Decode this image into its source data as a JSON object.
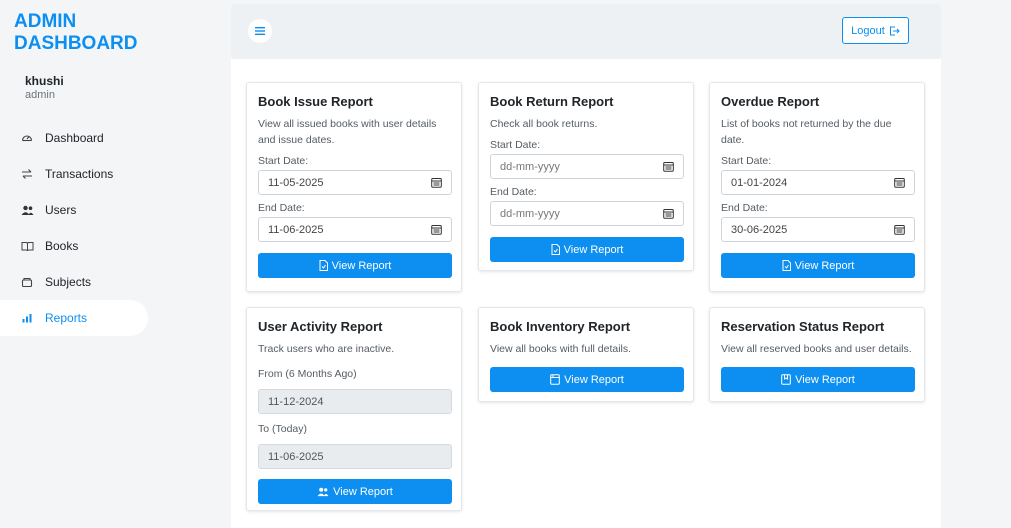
{
  "sidebar": {
    "brand": "ADMIN DASHBOARD",
    "user": {
      "name": "khushi",
      "role": "admin"
    },
    "items": [
      {
        "label": "Dashboard",
        "icon": "dashboard-icon"
      },
      {
        "label": "Transactions",
        "icon": "transactions-icon"
      },
      {
        "label": "Users",
        "icon": "users-icon"
      },
      {
        "label": "Books",
        "icon": "book-icon"
      },
      {
        "label": "Subjects",
        "icon": "subjects-icon"
      },
      {
        "label": "Reports",
        "icon": "reports-icon",
        "active": true
      }
    ]
  },
  "header": {
    "logout_label": "Logout"
  },
  "colors": {
    "accent": "#0d8ff2",
    "sidebar_bg": "#f3f5f7",
    "readonly_bg": "#e9ecef"
  },
  "cards": {
    "issue": {
      "title": "Book Issue Report",
      "desc": "View all issued books with user details and issue dates.",
      "start_label": "Start Date:",
      "start_value": "11-05-2025",
      "end_label": "End Date:",
      "end_value": "11-06-2025",
      "button": "View Report"
    },
    "return": {
      "title": "Book Return Report",
      "desc": "Check all book returns.",
      "start_label": "Start Date:",
      "start_value": "dd-mm-yyyy",
      "end_label": "End Date:",
      "end_value": "dd-mm-yyyy",
      "button": "View Report"
    },
    "overdue": {
      "title": "Overdue Report",
      "desc": "List of books not returned by the due date.",
      "start_label": "Start Date:",
      "start_value": "01-01-2024",
      "end_label": "End Date:",
      "end_value": "30-06-2025",
      "button": "View Report"
    },
    "activity": {
      "title": "User Activity Report",
      "desc": "Track users who are inactive.",
      "from_label": "From (6 Months Ago)",
      "from_value": "11-12-2024",
      "to_label": "To (Today)",
      "to_value": "11-06-2025",
      "button": "View Report"
    },
    "inventory": {
      "title": "Book Inventory Report",
      "desc": "View all books with full details.",
      "button": "View Report"
    },
    "reservation": {
      "title": "Reservation Status Report",
      "desc": "View all reserved books and user details.",
      "button": "View Report"
    }
  }
}
